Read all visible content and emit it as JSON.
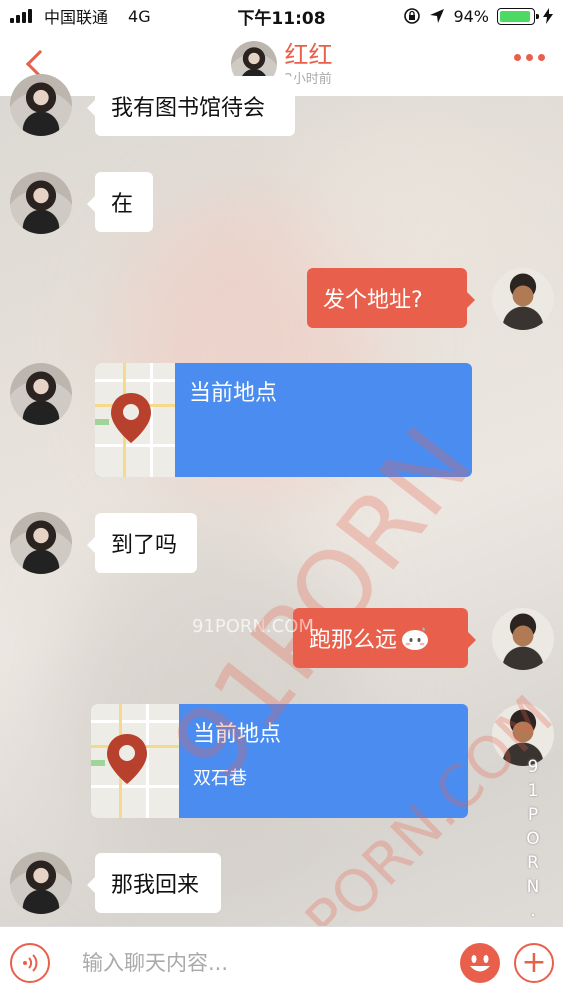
{
  "status_bar": {
    "carrier": "中国联通",
    "network": "4G",
    "time": "下午11:08",
    "battery_text": "94%",
    "battery_level": 0.94
  },
  "header": {
    "name": "红红",
    "last_seen": "2小时前"
  },
  "messages": [
    {
      "side": "left",
      "type": "text",
      "text": "我有图书馆待会"
    },
    {
      "side": "left",
      "type": "text",
      "text": "在"
    },
    {
      "side": "right",
      "type": "text",
      "text": "发个地址?"
    },
    {
      "side": "left",
      "type": "location",
      "title": "当前地点",
      "subtitle": ""
    },
    {
      "side": "left",
      "type": "text",
      "text": "到了吗"
    },
    {
      "side": "right",
      "type": "text",
      "text": "跑那么远",
      "emoji": "sweat-emoji"
    },
    {
      "side": "right",
      "type": "location",
      "title": "当前地点",
      "subtitle": "双石巷"
    },
    {
      "side": "left",
      "type": "text",
      "text": "那我回来"
    }
  ],
  "input": {
    "placeholder": "输入聊天内容..."
  },
  "watermark": {
    "small": "91PORN.COM",
    "large": "91PORN",
    "large2": "91PORN.COM",
    "vertical": "91PORN.COM"
  },
  "colors": {
    "accent": "#e8604c",
    "location_bg": "#4a8cf0"
  },
  "icons": [
    "back-arrow-icon",
    "more-dots-icon",
    "voice-icon",
    "emoji-icon",
    "plus-icon",
    "map-pin-icon",
    "location-arrow-icon",
    "lock-rotation-icon",
    "charging-icon"
  ]
}
